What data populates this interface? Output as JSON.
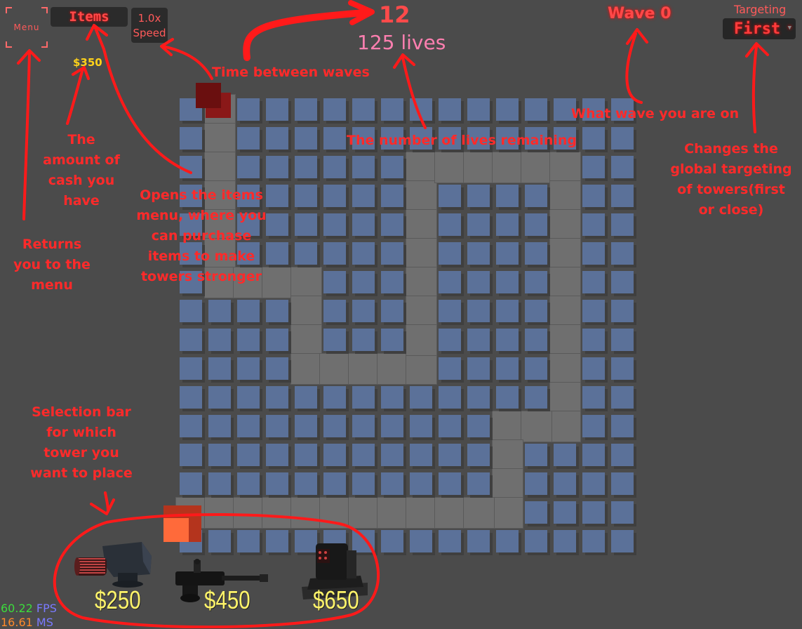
{
  "hud": {
    "menu_label": "Menu",
    "items_label": "Items",
    "speed_value": "1.0x",
    "speed_label": "Speed",
    "cash": "$350",
    "timer": "12",
    "lives": "125 lives",
    "wave": "Wave 0",
    "targeting_label": "Targeting",
    "targeting_value": "First"
  },
  "towers": [
    {
      "name": "gatling-turret",
      "price": "$250"
    },
    {
      "name": "rifle-turret",
      "price": "$450"
    },
    {
      "name": "missile-turret",
      "price": "$650"
    }
  ],
  "stats": {
    "fps_value": "60.22",
    "fps_label": "FPS",
    "ms_value": "16.61",
    "ms_label": "MS"
  },
  "annotations": {
    "time_between_waves": "Time between waves",
    "wave_info": "What wave you are on",
    "lives_info": "The number of lives remaining",
    "cash_info": "The amount of cash you have",
    "targeting_info": "Changes the global targeting of towers(first or close)",
    "items_info": "Opens the items menu, where you can purchase items to make towers stronger",
    "menu_info": "Returns you to the menu",
    "selection_info": "Selection bar for which tower you want to place"
  },
  "colors": {
    "background": "#4b4b4b",
    "tile": "#5b7199",
    "path": "#6f6f6f",
    "annotation": "#ff2a2a",
    "cash": "#ffd21a",
    "price": "#fff46a"
  }
}
